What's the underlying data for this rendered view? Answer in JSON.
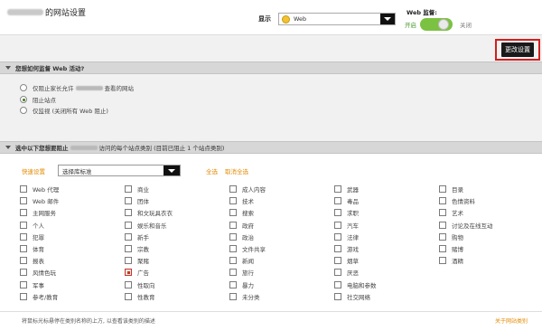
{
  "header": {
    "title_suffix": "的网站设置",
    "display_label": "显示",
    "display_value": "Web",
    "web_monitor_label": "Web 监督:",
    "toggle_on_label": "开启",
    "toggle_off_label": "关闭",
    "toggle_state": "on"
  },
  "toolbar": {
    "save_label": "更改设置"
  },
  "monitor_section": {
    "heading": "您想如何监督 Web 活动?",
    "options": [
      {
        "label_pre": "仅阻止家长允许",
        "label_post": "查看的网站",
        "checked": false
      },
      {
        "label_pre": "阻止站点",
        "label_post": "",
        "checked": true
      },
      {
        "label_pre": "仅监视 (关闭所有 Web 阻止)",
        "label_post": "",
        "checked": false
      }
    ]
  },
  "block_section": {
    "heading_pre": "选中以下您想要阻止",
    "heading_post": "访问的每个站点类别 (目前已阻止 1 个站点类别)",
    "quick_label": "快速设置",
    "quick_select_value": "选择库标准",
    "select_all": "全选",
    "deselect_all": "取消全选",
    "columns": [
      [
        {
          "label": "Web 代理",
          "checked": false
        },
        {
          "label": "Web 邮件",
          "checked": false
        },
        {
          "label": "主网服务",
          "checked": false
        },
        {
          "label": "个人",
          "checked": false
        },
        {
          "label": "犯罪",
          "checked": false
        },
        {
          "label": "体育",
          "checked": false
        },
        {
          "label": "报表",
          "checked": false
        },
        {
          "label": "风情色玩",
          "checked": false
        },
        {
          "label": "军事",
          "checked": false
        },
        {
          "label": "参考/教育",
          "checked": false
        }
      ],
      [
        {
          "label": "商业",
          "checked": false
        },
        {
          "label": "团体",
          "checked": false
        },
        {
          "label": "和文玩具衣衣",
          "checked": false
        },
        {
          "label": "娱乐和音乐",
          "checked": false
        },
        {
          "label": "新手",
          "checked": false
        },
        {
          "label": "宗教",
          "checked": false
        },
        {
          "label": "聚赌",
          "checked": false
        },
        {
          "label": "广告",
          "checked": true
        },
        {
          "label": "性取向",
          "checked": false
        },
        {
          "label": "性教育",
          "checked": false
        }
      ],
      [
        {
          "label": "成人内容",
          "checked": false
        },
        {
          "label": "技术",
          "checked": false
        },
        {
          "label": "搜索",
          "checked": false
        },
        {
          "label": "政府",
          "checked": false
        },
        {
          "label": "政治",
          "checked": false
        },
        {
          "label": "文件共享",
          "checked": false
        },
        {
          "label": "新闻",
          "checked": false
        },
        {
          "label": "旅行",
          "checked": false
        },
        {
          "label": "暴力",
          "checked": false
        },
        {
          "label": "未分类",
          "checked": false
        }
      ],
      [
        {
          "label": "武器",
          "checked": false
        },
        {
          "label": "毒品",
          "checked": false
        },
        {
          "label": "求职",
          "checked": false
        },
        {
          "label": "汽车",
          "checked": false
        },
        {
          "label": "法律",
          "checked": false
        },
        {
          "label": "游戏",
          "checked": false
        },
        {
          "label": "烟草",
          "checked": false
        },
        {
          "label": "厌恶",
          "checked": false
        },
        {
          "label": "电脑和参数",
          "checked": false
        },
        {
          "label": "社交网络",
          "checked": false
        }
      ],
      [
        {
          "label": "目录",
          "checked": false
        },
        {
          "label": "色情资料",
          "checked": false
        },
        {
          "label": "艺术",
          "checked": false
        },
        {
          "label": "讨论及在线互动",
          "checked": false
        },
        {
          "label": "购物",
          "checked": false
        },
        {
          "label": "赌博",
          "checked": false
        },
        {
          "label": "酒精",
          "checked": false
        }
      ]
    ]
  },
  "footer": {
    "note": "将鼠标光标悬停在类别名称的上方, 以查看该类别的描述",
    "link": "关于网站类别"
  }
}
